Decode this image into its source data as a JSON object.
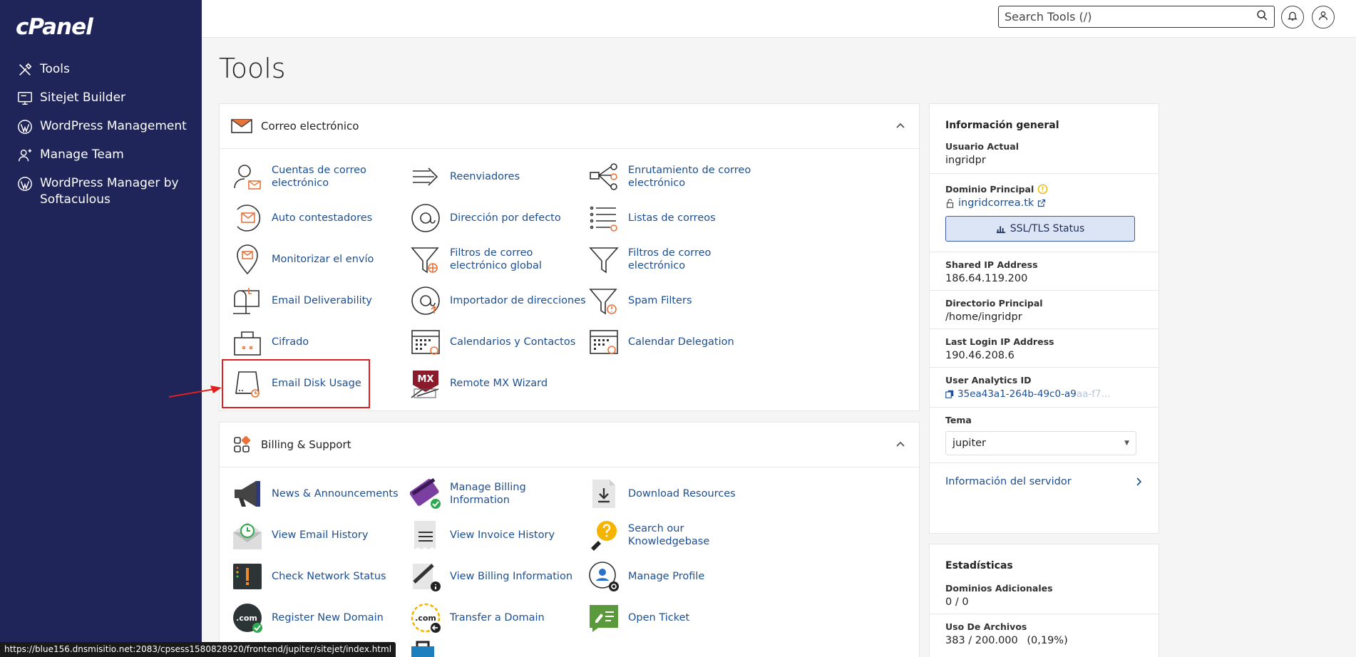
{
  "app": {
    "logo": "cPanel"
  },
  "sidebar": {
    "items": [
      {
        "label": "Tools",
        "icon": "tools-icon"
      },
      {
        "label": "Sitejet Builder",
        "icon": "monitor-icon"
      },
      {
        "label": "WordPress Management",
        "icon": "wordpress-icon"
      },
      {
        "label": "Manage Team",
        "icon": "team-icon"
      },
      {
        "label": "WordPress Manager by Softaculous",
        "icon": "wordpress-icon"
      }
    ]
  },
  "topbar": {
    "search_placeholder": "Search Tools (/)"
  },
  "page": {
    "title": "Tools"
  },
  "email_section": {
    "title": "Correo electrónico",
    "tools": [
      {
        "label": "Cuentas de correo electrónico",
        "icon": "email-accounts-icon"
      },
      {
        "label": "Reenviadores",
        "icon": "forwarders-icon"
      },
      {
        "label": "Enrutamiento de correo electrónico",
        "icon": "email-routing-icon"
      },
      {
        "label": "Auto contestadores",
        "icon": "autoresponders-icon"
      },
      {
        "label": "Dirección por defecto",
        "icon": "default-address-icon"
      },
      {
        "label": "Listas de correos",
        "icon": "mailing-lists-icon"
      },
      {
        "label": "Monitorizar el envío",
        "icon": "track-delivery-icon"
      },
      {
        "label": "Filtros de correo electrónico global",
        "icon": "global-filters-icon"
      },
      {
        "label": "Filtros de correo electrónico",
        "icon": "email-filters-icon"
      },
      {
        "label": "Email Deliverability",
        "icon": "mailbox-icon"
      },
      {
        "label": "Importador de direcciones",
        "icon": "address-importer-icon"
      },
      {
        "label": "Spam Filters",
        "icon": "spam-filters-icon"
      },
      {
        "label": "Cifrado",
        "icon": "encryption-icon"
      },
      {
        "label": "Calendarios y Contactos",
        "icon": "calendars-icon"
      },
      {
        "label": "Calendar Delegation",
        "icon": "calendar-delegation-icon"
      },
      {
        "label": "Email Disk Usage",
        "icon": "disk-usage-icon"
      },
      {
        "label": "Remote MX Wizard",
        "icon": "mx-wizard-icon"
      }
    ]
  },
  "billing_section": {
    "title": "Billing & Support",
    "tools": [
      {
        "label": "News & Announcements",
        "icon": "megaphone-icon"
      },
      {
        "label": "Manage Billing Information",
        "icon": "credit-card-icon"
      },
      {
        "label": "Download Resources",
        "icon": "download-icon"
      },
      {
        "label": "View Email History",
        "icon": "email-history-icon"
      },
      {
        "label": "View Invoice History",
        "icon": "invoice-icon"
      },
      {
        "label": "Search our Knowledgebase",
        "icon": "lightbulb-icon"
      },
      {
        "label": "Check Network Status",
        "icon": "network-status-icon"
      },
      {
        "label": "View Billing Information",
        "icon": "billing-info-icon"
      },
      {
        "label": "Manage Profile",
        "icon": "profile-icon"
      },
      {
        "label": "Register New Domain",
        "icon": "register-domain-icon"
      },
      {
        "label": "Transfer a Domain",
        "icon": "transfer-domain-icon"
      },
      {
        "label": "Open Ticket",
        "icon": "ticket-icon"
      }
    ]
  },
  "info": {
    "title": "Información general",
    "current_user_label": "Usuario Actual",
    "current_user": "ingridpr",
    "primary_domain_label": "Dominio Principal",
    "primary_domain": "ingridcorrea.tk",
    "ssl_button": "SSL/TLS Status",
    "shared_ip_label": "Shared IP Address",
    "shared_ip": "186.64.119.200",
    "home_dir_label": "Directorio Principal",
    "home_dir": "/home/ingridpr",
    "last_login_label": "Last Login IP Address",
    "last_login": "190.46.208.6",
    "analytics_label": "User Analytics ID",
    "analytics_id": "35ea43a1-264b-49c0-a9",
    "analytics_id_fade": "aa-f7...",
    "theme_label": "Tema",
    "theme_value": "jupiter",
    "server_info": "Información del servidor"
  },
  "stats": {
    "title": "Estadísticas",
    "addon_label": "Dominios Adicionales",
    "addon_value": "0 / 0",
    "files_label": "Uso De Archivos",
    "files_value": "383 / 200.000",
    "files_pct": "(0,19%)"
  },
  "statusbar": {
    "url": "https://blue156.dnsmisitio.net:2083/cpsess1580828920/frontend/jupiter/sitejet/index.html"
  },
  "colors": {
    "sidebar": "#1f2559",
    "link": "#1d4f91",
    "accent": "#e8733a",
    "highlight": "#e0201e"
  }
}
